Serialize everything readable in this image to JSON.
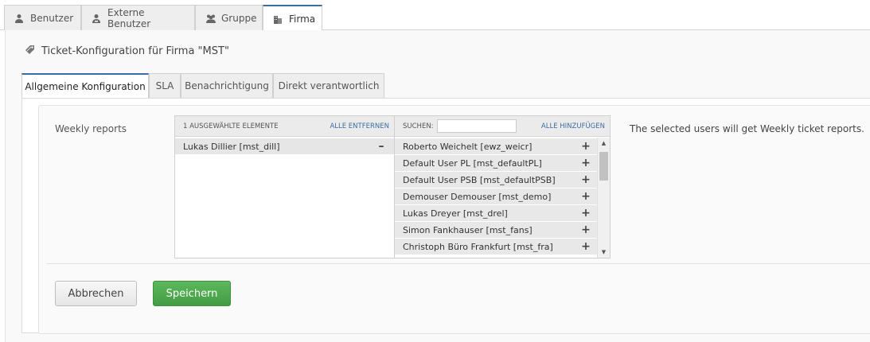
{
  "top_tabs": [
    {
      "label": "Benutzer",
      "icon": "user-icon"
    },
    {
      "label": "Externe Benutzer",
      "icon": "external-user-icon"
    },
    {
      "label": "Gruppe",
      "icon": "group-icon"
    },
    {
      "label": "Firma",
      "icon": "building-icon",
      "active": true
    }
  ],
  "page": {
    "title": "Ticket-Konfiguration für Firma \"MST\"",
    "title_icon": "tag-icon"
  },
  "sub_tabs": [
    {
      "label": "Allgemeine Konfiguration",
      "active": true
    },
    {
      "label": "SLA"
    },
    {
      "label": "Benachrichtigung"
    },
    {
      "label": "Direkt verantwortlich"
    }
  ],
  "form": {
    "field_label": "Weekly reports",
    "help_text": "The selected users will get Weekly ticket reports.",
    "selected": {
      "header": "1 ausgewählte Elemente",
      "remove_all": "Alle entfernen",
      "items": [
        {
          "label": "Lukas Dillier [mst_dill]",
          "action": "–"
        }
      ]
    },
    "available": {
      "search_label": "Suchen:",
      "search_value": "",
      "add_all": "Alle hinzufügen",
      "items": [
        {
          "label": "Roberto Weichelt [ewz_weicr]",
          "action": "+"
        },
        {
          "label": "Default User PL [mst_defaultPL]",
          "action": "+"
        },
        {
          "label": "Default User PSB [mst_defaultPSB]",
          "action": "+"
        },
        {
          "label": "Demouser Demouser [mst_demo]",
          "action": "+"
        },
        {
          "label": "Lukas Dreyer [mst_drel]",
          "action": "+"
        },
        {
          "label": "Simon Fankhauser [mst_fans]",
          "action": "+"
        },
        {
          "label": "Christoph Büro Frankfurt [mst_fra]",
          "action": "+"
        }
      ]
    },
    "scroll_up": "▲",
    "scroll_down": "▼"
  },
  "buttons": {
    "cancel": "Abbrechen",
    "save": "Speichern"
  },
  "colors": {
    "accent": "#3a6ea5",
    "save_button": "#4cae4c"
  }
}
